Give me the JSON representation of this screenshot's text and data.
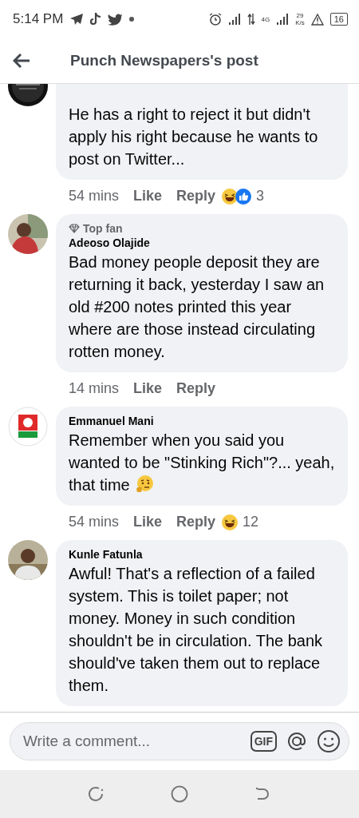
{
  "status_bar": {
    "time": "5:14 PM",
    "network": "4G",
    "speed_value": "29",
    "speed_unit": "K/s",
    "battery": "16"
  },
  "header": {
    "title": "Punch Newspapers's post"
  },
  "comments": [
    {
      "top_fan": false,
      "body": "He has a right to reject it but didn't apply his right because he wants to post on Twitter...",
      "emoji": false,
      "time": "54 mins",
      "like": "Like",
      "reply": "Reply",
      "haha_reaction": true,
      "like_reaction": true,
      "reaction_count": "3"
    },
    {
      "author": "Adeoso Olajide",
      "top_fan": true,
      "top_fan_label": "Top fan",
      "body": "Bad money people deposit they are returning it back, yesterday I saw an old #200 notes printed this year where are those instead circulating rotten money.",
      "emoji": false,
      "time": "14 mins",
      "like": "Like",
      "reply": "Reply",
      "haha_reaction": false,
      "like_reaction": false
    },
    {
      "author": "Emmanuel Mani",
      "top_fan": false,
      "body": "Remember when you said you wanted to be \"Stinking Rich\"?... yeah, that time",
      "emoji": true,
      "time": "54 mins",
      "like": "Like",
      "reply": "Reply",
      "haha_reaction": true,
      "like_reaction": false,
      "reaction_count": "12"
    },
    {
      "author": "Kunle Fatunla",
      "top_fan": false,
      "body": "Awful! That's a reflection of a failed system. This is toilet paper; not money. Money in such condition shouldn't be in circulation. The bank should've taken them out to replace them.",
      "emoji": false
    }
  ],
  "composer": {
    "placeholder": "Write a comment...",
    "gif_label": "GIF"
  }
}
